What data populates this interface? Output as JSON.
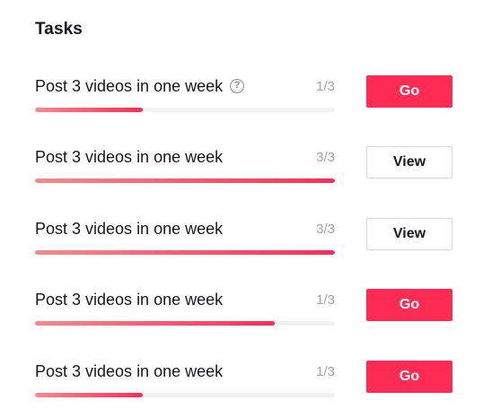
{
  "panel": {
    "title": "Tasks"
  },
  "tasks": [
    {
      "name": "Post 3 videos in one week",
      "count": "1/3",
      "progress": 0.36,
      "action": "Go",
      "action_style": "primary",
      "has_help_icon": true
    },
    {
      "name": "Post 3 videos in one week",
      "count": "3/3",
      "progress": 1.0,
      "action": "View",
      "action_style": "secondary",
      "has_help_icon": false
    },
    {
      "name": "Post 3 videos in one week",
      "count": "3/3",
      "progress": 1.0,
      "action": "View",
      "action_style": "secondary",
      "has_help_icon": false
    },
    {
      "name": "Post 3 videos in one week",
      "count": "1/3",
      "progress": 0.8,
      "action": "Go",
      "action_style": "primary",
      "has_help_icon": false
    },
    {
      "name": "Post 3 videos in one week",
      "count": "1/3",
      "progress": 0.36,
      "action": "Go",
      "action_style": "primary",
      "has_help_icon": false
    }
  ],
  "icons": {
    "help": "question-circle-icon",
    "help_glyph": "?"
  },
  "colors": {
    "accent": "#fe2c55",
    "progress_start": "#f48b8e",
    "progress_track": "#f1f1f2",
    "muted_text": "#a2a3a8"
  }
}
